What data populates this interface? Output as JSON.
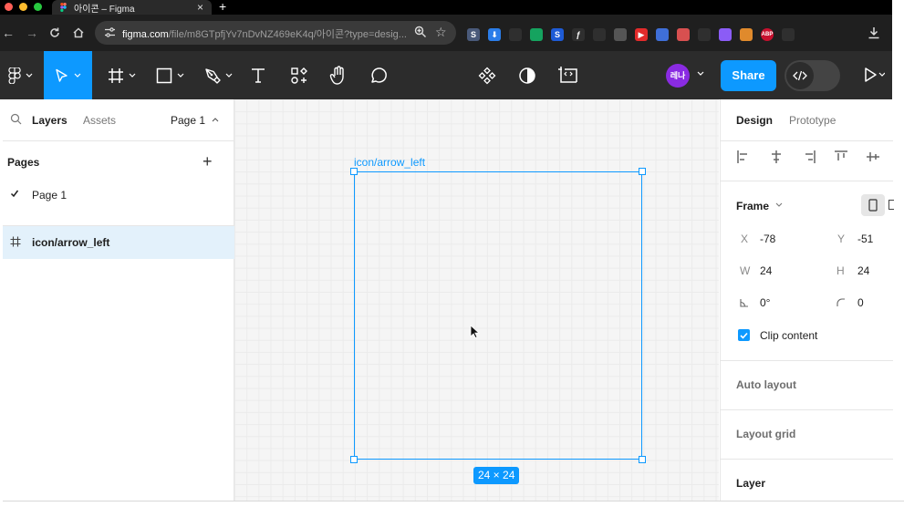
{
  "browser": {
    "tab_title": "아이콘 – Figma",
    "tab_close": "×",
    "new_tab": "+",
    "url_host": "figma.com",
    "url_path": "/file/m8GTpfjYv7nDvNZ469eK4q/아이콘?type=desig...",
    "extensions": [
      {
        "label": "S",
        "color": "#4a5a7a"
      },
      {
        "label": "⬇",
        "color": "#2b7de9"
      },
      {
        "label": "",
        "color": "#2f2f2f"
      },
      {
        "label": "",
        "color": "#15a35f"
      },
      {
        "label": "S",
        "color": "#1e5bd6"
      },
      {
        "label": "ƒ",
        "color": "#2f2f2f"
      },
      {
        "label": "",
        "color": "#2f2f2f"
      },
      {
        "label": "",
        "color": "#555555"
      },
      {
        "label": "▶",
        "color": "#e32b2b"
      },
      {
        "label": "",
        "color": "#3f6fd8"
      },
      {
        "label": "",
        "color": "#d85050"
      },
      {
        "label": "",
        "color": "#2f2f2f"
      },
      {
        "label": "",
        "color": "#8b5cf6"
      },
      {
        "label": "",
        "color": "#e08a2c"
      },
      {
        "label": "ABP",
        "color": "#c8102e"
      },
      {
        "label": "",
        "color": "#2f2f2f"
      }
    ]
  },
  "toolbar": {
    "avatar_text": "레나",
    "share_label": "Share",
    "accent": "#0d99ff"
  },
  "left_panel": {
    "tab_layers": "Layers",
    "tab_assets": "Assets",
    "page_select": "Page 1",
    "pages_heading": "Pages",
    "add_page": "+",
    "pages": [
      "Page 1"
    ],
    "layers": [
      "icon/arrow_left"
    ]
  },
  "canvas": {
    "frame_name": "icon/arrow_left",
    "size_badge": "24 × 24"
  },
  "right_panel": {
    "tab_design": "Design",
    "tab_prototype": "Prototype",
    "frame_heading": "Frame",
    "x_label": "X",
    "x_value": "-78",
    "y_label": "Y",
    "y_value": "-51",
    "w_label": "W",
    "w_value": "24",
    "h_label": "H",
    "h_value": "24",
    "rotation_value": "0°",
    "radius_value": "0",
    "clip_content_label": "Clip content",
    "auto_layout": "Auto layout",
    "layout_grid": "Layout grid",
    "layer": "Layer"
  }
}
